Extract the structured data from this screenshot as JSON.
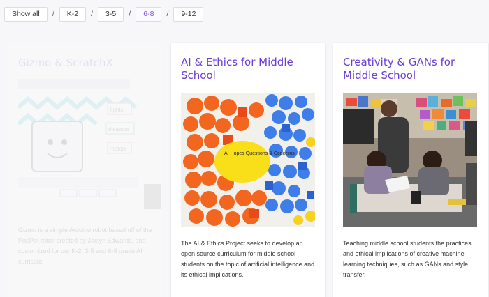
{
  "filters": {
    "items": [
      {
        "label": "Show all"
      },
      {
        "label": "K-2"
      },
      {
        "label": "3-5"
      },
      {
        "label": "6-8"
      },
      {
        "label": "9-12"
      }
    ],
    "separator": "/",
    "active": "6-8",
    "active_color": "#7a56d6"
  },
  "cards": [
    {
      "title": "Gizmo & ScratchX",
      "description": "Gizmo is a simple Arduino robot based off of the PopPet robot created by Jaclyn Edwards, and customized for our K-2, 3-5 and 6-8 grade AI curricula.",
      "image_labels": {
        "lights": "lights",
        "distance": "distance",
        "motors": "motors"
      },
      "faded": true
    },
    {
      "title": "AI & Ethics for Middle School",
      "description": "The AI & Ethics Project seeks to develop an open source curriculum for middle school students on the topic of artificial intelligence and its ethical implications.",
      "image_text": "AI Hopes Questions & Concerns"
    },
    {
      "title": "Creativity & GANs for Middle School",
      "description": "Teaching middle school students the practices and ethical implications of creative machine learning techniques, such as GANs and style transfer."
    }
  ],
  "colors": {
    "title": "#6a3ed6",
    "background": "#f7f7f9"
  }
}
